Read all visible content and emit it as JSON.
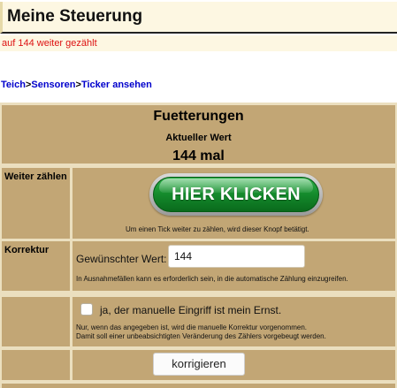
{
  "header": {
    "title": "Meine Steuerung"
  },
  "message": "auf 144 weiter gezählt",
  "breadcrumb": {
    "items": [
      "Teich",
      "Sensoren",
      "Ticker ansehen"
    ],
    "separator": ">"
  },
  "panel": {
    "title": "Fuetterungen",
    "subtitle": "Aktueller Wert",
    "current_value": "144 mal"
  },
  "weiter": {
    "label": "Weiter zählen",
    "button_label": "HIER KLICKEN",
    "hint": "Um einen Tick weiter zu zählen, wird dieser Knopf betätigt."
  },
  "korrektur": {
    "label": "Korrektur",
    "field_label": "Gewünschter Wert:",
    "field_value": "144",
    "hint": "In Ausnahmefällen kann es erforderlich sein, in die automatische Zählung einzugreifen."
  },
  "confirm": {
    "checkbox_label": "ja, der manuelle Eingriff ist mein Ernst.",
    "checked": false,
    "hint_line1": "Nur, wenn das angegeben ist, wird die manuelle Korrektur vorgenommen.",
    "hint_line2": "Damit soll einer unbeabsichtigten Veränderung des Zählers vorgebeugt werden."
  },
  "submit": {
    "label": "korrigieren"
  },
  "colors": {
    "title_bg": "#fdf7e2",
    "message_red": "#dd1111",
    "link_blue": "#0000cc",
    "panel_bg": "#ebdfbf",
    "cell_bg": "#c2a675",
    "button_green": "#148a2c"
  },
  "icons": {
    "checkbox": "checkbox-unchecked-icon"
  }
}
